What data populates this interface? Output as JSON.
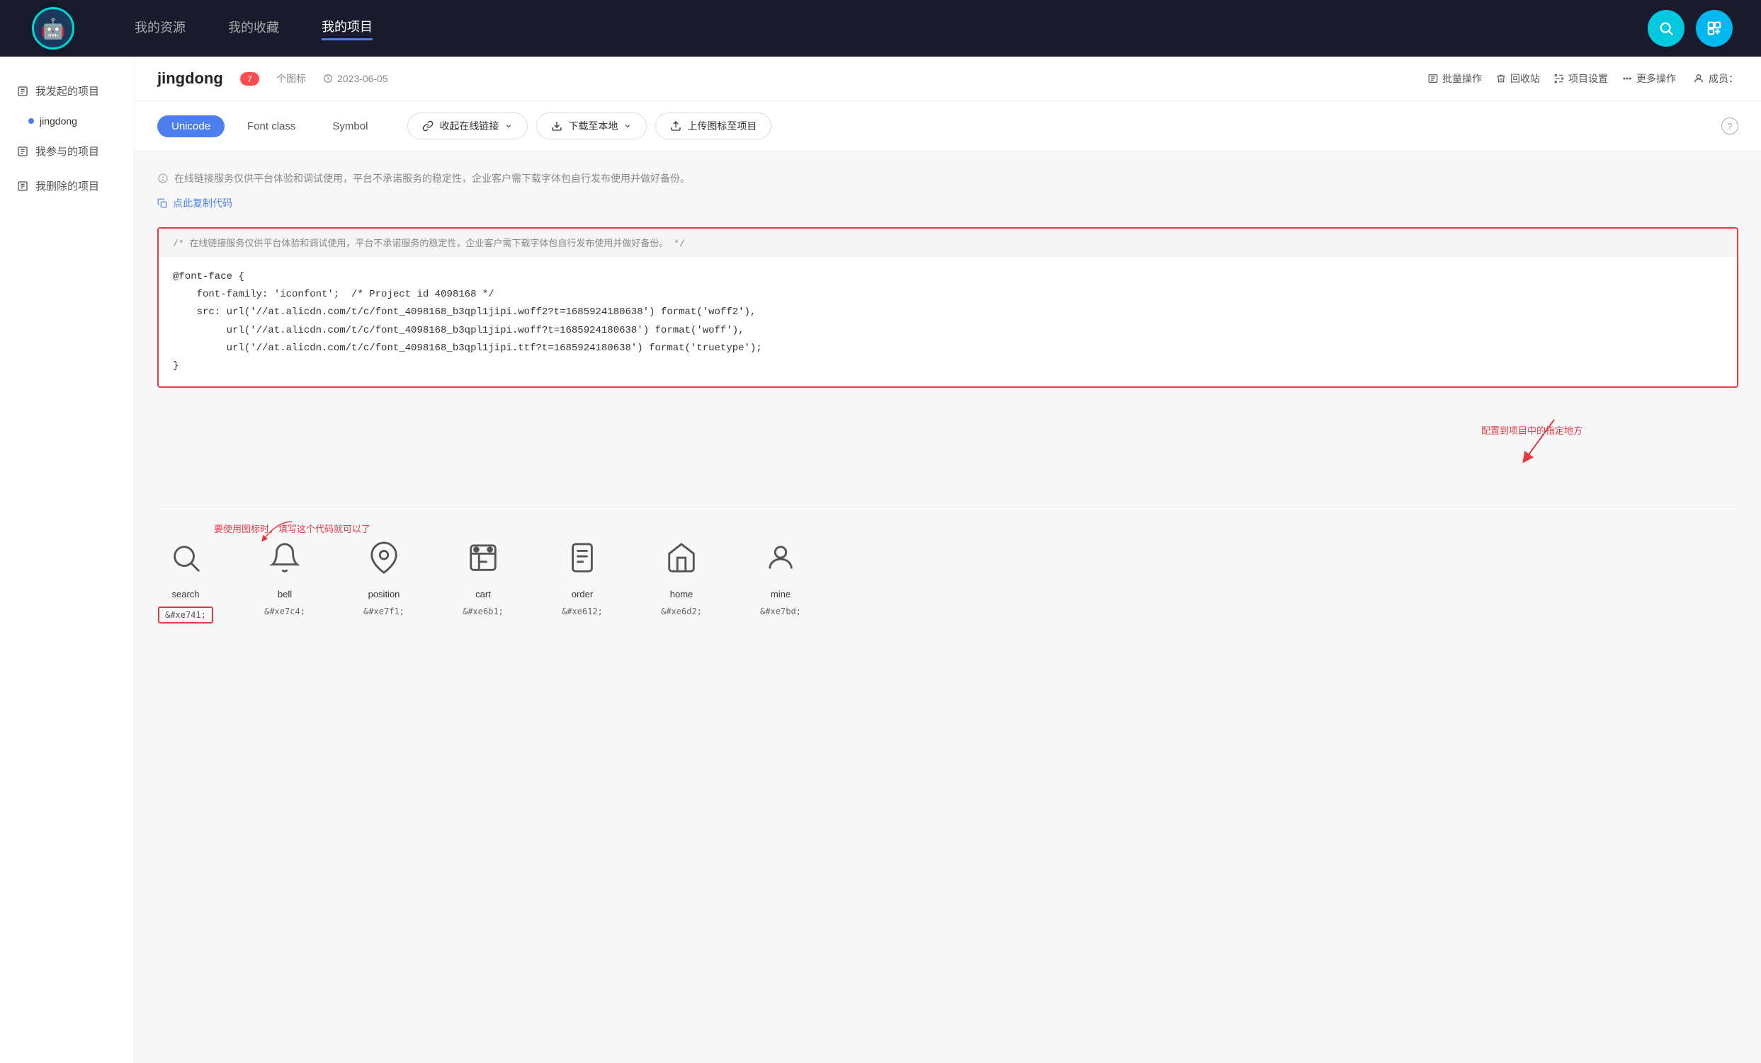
{
  "header": {
    "nav_items": [
      {
        "label": "我的资源",
        "active": false
      },
      {
        "label": "我的收藏",
        "active": false
      },
      {
        "label": "我的项目",
        "active": true
      }
    ],
    "search_label": "搜索",
    "add_label": "新增"
  },
  "sidebar": {
    "my_started": "我发起的项目",
    "projects": [
      {
        "label": "jingdong"
      }
    ],
    "my_joined": "我参与的项目",
    "my_deleted": "我删除的项目"
  },
  "project": {
    "name": "jingdong",
    "count": "7",
    "count_label": "个图标",
    "date_icon": "clock",
    "date": "2023-06-05",
    "batch_label": "批量操作",
    "recycle_label": "回收站",
    "settings_label": "项目设置",
    "more_label": "更多操作",
    "member_label": "成员："
  },
  "tabs": {
    "items": [
      {
        "label": "Unicode",
        "active": true
      },
      {
        "label": "Font class",
        "active": false
      },
      {
        "label": "Symbol",
        "active": false
      }
    ],
    "collapse_label": "收起在线链接",
    "download_label": "下载至本地",
    "upload_label": "上传图标至项目",
    "help_label": "?"
  },
  "content": {
    "notice_text": "在线链接服务仅供平台体验和调试使用，平台不承诺服务的稳定性，企业客户需下载字体包自行发布使用并做好备份。",
    "copy_label": "点此复制代码",
    "code_comment": "/*  在线链接服务仅供平台体验和调试使用，平台不承诺服务的稳定性，企业客户需下载字体包自行发布使用并做好备份。  */",
    "code_lines": [
      "@font-face {",
      "    font-family: 'iconfont';  /* Project id 4098168 */",
      "    src: url('//at.alicdn.com/t/c/font_4098168_b3qpl1jipi.woff2?t=1685924180638') format('woff2'),",
      "         url('//at.alicdn.com/t/c/font_4098168_b3qpl1jipi.woff?t=1685924180638') format('woff'),",
      "         url('//at.alicdn.com/t/c/font_4098168_b3qpl1jipi.ttf?t=1685924180638') format('truetype');",
      "}"
    ],
    "annotation": "配置到项目中的指定地方",
    "instruction": "要使用图标时，填写这个代码就可以了"
  },
  "icons": [
    {
      "name": "search",
      "symbol": "🔍",
      "code": "&#xe741;",
      "highlighted": true
    },
    {
      "name": "bell",
      "symbol": "🔔",
      "code": "&#xe7c4;",
      "highlighted": false
    },
    {
      "name": "position",
      "symbol": "📍",
      "code": "&#xe7f1;",
      "highlighted": false
    },
    {
      "name": "cart",
      "symbol": "🛒",
      "code": "&#xe6b1;",
      "highlighted": false
    },
    {
      "name": "order",
      "symbol": "📋",
      "code": "&#xe612;",
      "highlighted": false
    },
    {
      "name": "home",
      "symbol": "🏠",
      "code": "&#xe6d2;",
      "highlighted": false
    },
    {
      "name": "mine",
      "symbol": "👤",
      "code": "&#xe7bd;",
      "highlighted": false
    }
  ]
}
